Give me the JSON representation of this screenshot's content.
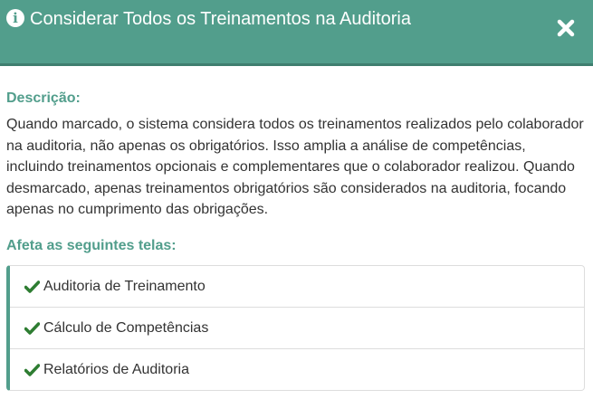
{
  "dialog": {
    "title": "Considerar Todos os Treinamentos na Auditoria",
    "icon": "info-circle-icon",
    "close_icon": "close-icon",
    "header_color": "#529e8c",
    "accent_color": "#529e8c",
    "check_color": "#2e7d32"
  },
  "description": {
    "label": "Descrição:",
    "text": "Quando marcado, o sistema considera todos os treinamentos realizados pelo colaborador na auditoria, não apenas os obrigatórios. Isso amplia a análise de competências, incluindo treinamentos opcionais e complementares que o colaborador realizou. Quando desmarcado, apenas treinamentos obrigatórios são considerados na auditoria, focando apenas no cumprimento das obrigações."
  },
  "affected_screens": {
    "label": "Afeta as seguintes telas:",
    "items": [
      {
        "label": "Auditoria de Treinamento",
        "icon": "check-icon"
      },
      {
        "label": "Cálculo de Competências",
        "icon": "check-icon"
      },
      {
        "label": "Relatórios de Auditoria",
        "icon": "check-icon"
      }
    ]
  }
}
